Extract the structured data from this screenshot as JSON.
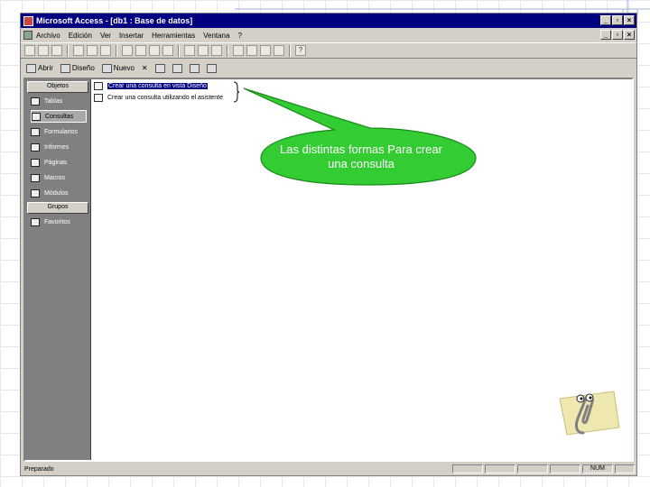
{
  "window": {
    "title": "Microsoft Access - [db1 : Base de datos]"
  },
  "menu": {
    "items": [
      "Archivo",
      "Edición",
      "Ver",
      "Insertar",
      "Herramientas",
      "Ventana",
      "?"
    ]
  },
  "db_toolbar": {
    "open_label": "Abrir",
    "design_label": "Diseño",
    "new_label": "Nuevo"
  },
  "objects_panel": {
    "header": "Objetos",
    "items": [
      "Tablas",
      "Consultas",
      "Formularios",
      "Informes",
      "Páginas",
      "Macros",
      "Módulos"
    ],
    "selected_index": 1,
    "groups_header": "Grupos",
    "group_items": [
      "Favoritos"
    ]
  },
  "list": {
    "items": [
      "Crear una consulta en vista Diseño",
      "Crear una consulta utilizando el asistente"
    ],
    "selected_index": 0
  },
  "callout": {
    "text": "Las distintas formas Para crear una consulta",
    "fill_color": "#33cc33"
  },
  "statusbar": {
    "text": "Preparado",
    "num_indicator": "NUM"
  },
  "colors": {
    "titlebar": "#000080",
    "objects_bar": "#808080",
    "window_face": "#d4d0c8"
  },
  "icons": {
    "assistant": "clippy-paperclip-icon"
  }
}
